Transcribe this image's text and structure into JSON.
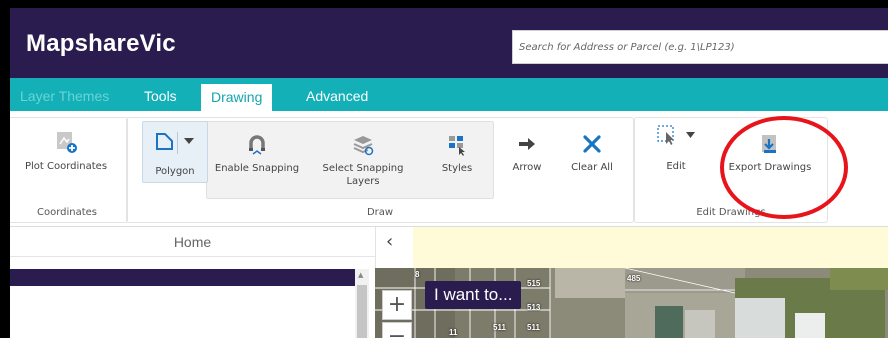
{
  "header": {
    "app_title": "MapshareVic",
    "search_placeholder": "Search for Address or Parcel (e.g. 1\\LP123)"
  },
  "tabs": [
    {
      "label": "Layer Themes"
    },
    {
      "label": "Tools"
    },
    {
      "label": "Drawing"
    },
    {
      "label": "Advanced"
    }
  ],
  "ribbon": {
    "plot_coordinates": "Plot Coordinates",
    "coordinates_group": "Coordinates",
    "polygon": "Polygon",
    "enable_snapping": "Enable Snapping",
    "select_snapping_layers": "Select Snapping Layers",
    "styles": "Styles",
    "arrow": "Arrow",
    "clear_all": "Clear All",
    "draw_group": "Draw",
    "edit": "Edit",
    "export_drawings": "Export Drawings",
    "edit_drawings_group": "Edit Drawings"
  },
  "side_panel": {
    "home_tab": "Home"
  },
  "map": {
    "i_want_to": "I want to...",
    "parcels": [
      "8",
      "515",
      "485",
      "513",
      "511",
      "511",
      "11"
    ]
  },
  "colors": {
    "header_bg": "#2a1c4e",
    "tab_bar": "#13b0b8",
    "highlight_circle": "#e8141b",
    "notice_bar": "#fffbd9"
  }
}
